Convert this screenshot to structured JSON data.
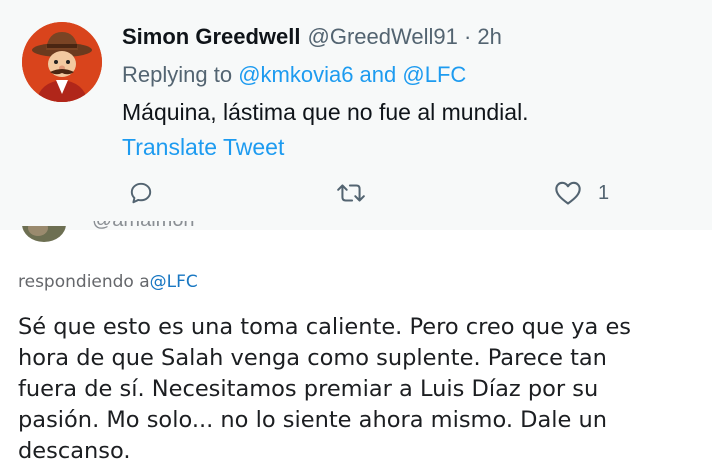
{
  "tweet": {
    "display_name": "Simon Greedwell",
    "handle_meta": "@GreedWell91 · 2h",
    "replying_prefix": "Replying to ",
    "replying_mentions": "@kmkovia6 and @LFC",
    "text": "Máquina, lástima que no fue al mundial.",
    "translate_label": "Translate Tweet",
    "actions": {
      "reply_icon": "reply-icon",
      "retweet_icon": "retweet-icon",
      "like_icon": "heart-icon",
      "like_count": "1"
    },
    "colors": {
      "accent": "#1d9bf0",
      "muted": "#536471",
      "card_bg": "#f7f9f9"
    }
  },
  "reply": {
    "handle_fragment": "@amalmoh",
    "context_prefix": "respondiendo a",
    "context_mention": "@LFC",
    "body_lines": [
      "Sé que esto es una toma caliente. Pero creo que ya es",
      "hora de que Salah venga como suplente. Parece tan",
      "fuera de sí. Necesitamos premiar a Luis Díaz por su",
      "pasión. Mo solo... no lo siente ahora mismo. Dale un",
      "descanso."
    ]
  }
}
